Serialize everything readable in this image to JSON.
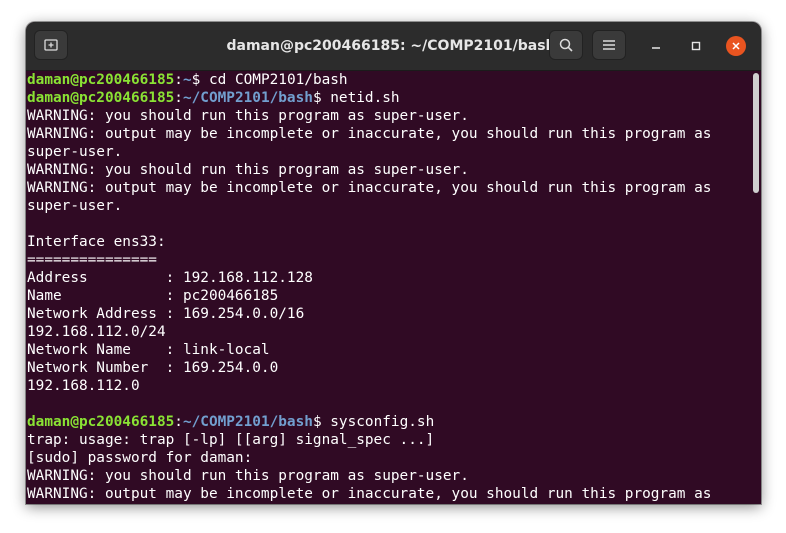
{
  "window": {
    "title": "daman@pc200466185: ~/COMP2101/bash",
    "icons": [
      "new-tab-icon",
      "search-icon",
      "hamburger-menu-icon",
      "minimize-icon",
      "maximize-icon",
      "close-icon"
    ],
    "colors": {
      "background": "#300a24",
      "user": "#8ae234",
      "path": "#729fcf",
      "close": "#e95420"
    }
  },
  "terminal": {
    "p1": {
      "user": "daman@pc200466185",
      "sep": ":",
      "path": "~",
      "dollar": "$",
      "cmd": " cd COMP2101/bash"
    },
    "p2": {
      "user": "daman@pc200466185",
      "sep": ":",
      "path": "~/COMP2101/bash",
      "dollar": "$",
      "cmd": " netid.sh"
    },
    "out1": [
      "WARNING: you should run this program as super-user.",
      "WARNING: output may be incomplete or inaccurate, you should run this program as",
      "super-user.",
      "WARNING: you should run this program as super-user.",
      "WARNING: output may be incomplete or inaccurate, you should run this program as",
      "super-user.",
      "",
      "Interface ens33:",
      "===============",
      "Address         : 192.168.112.128",
      "Name            : pc200466185",
      "Network Address : 169.254.0.0/16",
      "192.168.112.0/24",
      "Network Name    : link-local",
      "Network Number  : 169.254.0.0",
      "192.168.112.0",
      ""
    ],
    "p3": {
      "user": "daman@pc200466185",
      "sep": ":",
      "path": "~/COMP2101/bash",
      "dollar": "$",
      "cmd": " sysconfig.sh"
    },
    "out2": [
      "trap: usage: trap [-lp] [[arg] signal_spec ...]",
      "[sudo] password for daman:",
      "WARNING: you should run this program as super-user.",
      "WARNING: output may be incomplete or inaccurate, you should run this program as"
    ]
  }
}
